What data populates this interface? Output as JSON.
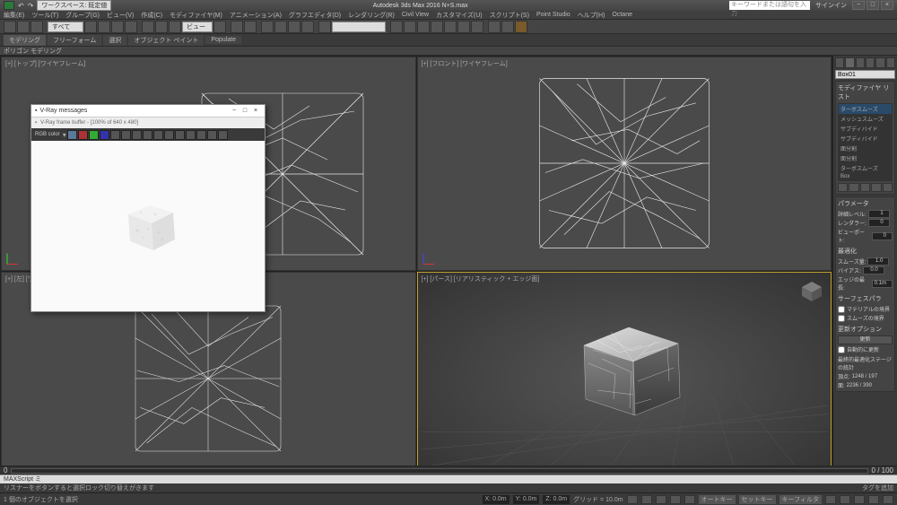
{
  "app": {
    "title": "Autodesk 3ds Max 2016   N+S.max",
    "workspace_label": "ワークスペース: 既定値",
    "search_placeholder": "キーワードまたは語句を入力",
    "signin": "サインイン"
  },
  "menu": {
    "items": [
      "編集(E)",
      "ツール(T)",
      "グループ(G)",
      "ビュー(V)",
      "作成(C)",
      "モディファイヤ(M)",
      "アニメーション(A)",
      "グラフエディタ(D)",
      "レンダリング(R)",
      "Civil View",
      "カスタマイズ(U)",
      "スクリプト(S)",
      "Point Studio",
      "ヘルプ(H)",
      "Octane"
    ]
  },
  "ribbon": {
    "tabs": [
      "モデリング",
      "フリーフォーム",
      "選択",
      "オブジェクト ペイント",
      "Populate"
    ],
    "section": "ポリゴン モデリング"
  },
  "viewports": {
    "top": "[+] [トップ] [ワイヤフレーム]",
    "front": "[+] [フロント] [ワイヤフレーム]",
    "left": "[+] [左] [ワイヤフレーム]",
    "persp": "[+] [パース] [リアリスティック + エッジ面]"
  },
  "render": {
    "window_title": "V-Ray messages",
    "frame_title": "V-Ray frame buffer - [100% of 640 x 480]",
    "channel": "RGB color"
  },
  "panel": {
    "obj_name": "Box01",
    "modifier_title": "モディファイヤ リスト",
    "modifiers": [
      "ターボスムーズ",
      "メッシュスムーズ",
      "サブディバイド",
      "サブディバイド",
      "面分割",
      "面分割",
      "ターボスムーズ",
      "Box"
    ],
    "params_title": "パラメータ",
    "iterations_label": "詳細レベル:",
    "iterations": "1",
    "render_iter_label": "レンダラー:",
    "render_iter": "0",
    "viewport_label": "ビューポート:",
    "viewport": "0",
    "smooth_title": "最適化",
    "smooth_label": "スムーズ量:",
    "smooth": "1.0",
    "separate_label": "バイアス:",
    "separate": "0.0",
    "edge_label": "エッジの最長:",
    "edge": "0.1m",
    "surface_title": "サーフェスパラ",
    "mat_label": "マテリアルの境界",
    "smg_label": "スムーズの境界",
    "update_title": "更新オプション",
    "update_btn": "更新",
    "auto_label": "自動的に更新",
    "stats_label": "最終的最適化ステージの統計",
    "verts_label": "頂点:",
    "verts": "1248 / 197",
    "faces_label": "面:",
    "faces": "2236 / 390"
  },
  "timeline": {
    "frame": "0",
    "range": "0 / 100"
  },
  "status": {
    "selection": "1 個のオブジェクトを選択",
    "x": "X: 0.0m",
    "y": "Y: 0.0m",
    "z": "Z: 0.0m",
    "grid": "グリッド = 10.0m",
    "autokey": "オートキー",
    "setkey": "セットキー",
    "filter": "キーフィルタ"
  },
  "maxscript": {
    "label": "MAXScript ミ"
  },
  "status2": {
    "hint": "リスナーをボタンすると選択ロック切り替えがきます",
    "tag": "タグを追加"
  }
}
